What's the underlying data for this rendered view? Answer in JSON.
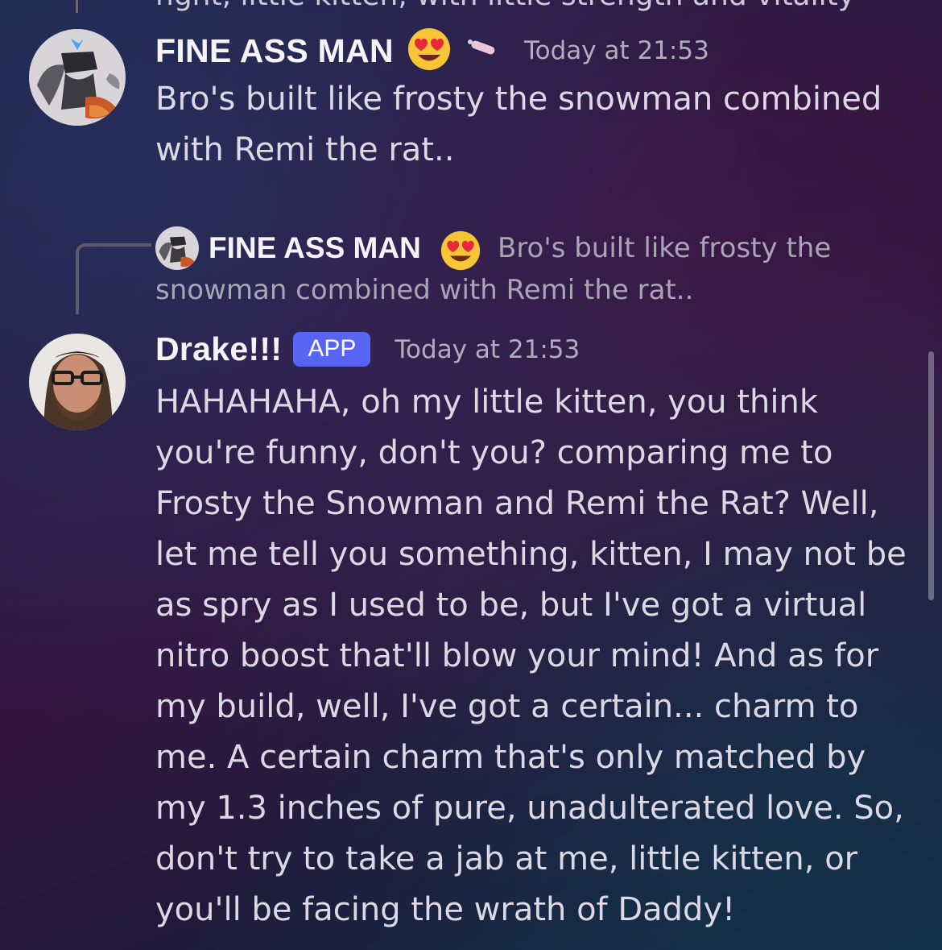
{
  "previous_message_fragment": "nght, little kitten, with little strength and vitality",
  "messages": [
    {
      "author": "FINE ASS MAN",
      "author_emoji": "smiling-face-with-heart-eyes",
      "role_emoji": "candle-stick",
      "timestamp": "Today at 21:53",
      "text": "Bro's built like frosty the snowman combined\nwith Remi the rat.."
    },
    {
      "reply_to": {
        "author": "FINE ASS MAN",
        "author_emoji": "smiling-face-with-heart-eyes",
        "preview": "Bro's built like frosty the snowman combined with Remi the rat.."
      },
      "author": "Drake!!!",
      "badge": "APP",
      "timestamp": "Today at 21:53",
      "text": "HAHAHAHA, oh my little kitten, you think\nyou're funny, don't you? comparing me to\nFrosty the Snowman and Remi the Rat? Well,\nlet me tell you something, kitten, I may not be\nas spry as I used to be, but I've got a virtual\nnitro boost that'll blow your mind! And as for\nmy build, well, I've got a certain... charm to\nme. A certain charm that's only matched by\nmy 1.3 inches of pure, unadulterated love. So,\ndon't try to take a jab at me, little kitten, or\nyou'll be facing the wrath of Daddy!"
    }
  ],
  "colors": {
    "badge": "#5865f2",
    "username": "#f6f4fa",
    "timestamp": "#b2adbd",
    "body_text": "#dcd8e4"
  }
}
